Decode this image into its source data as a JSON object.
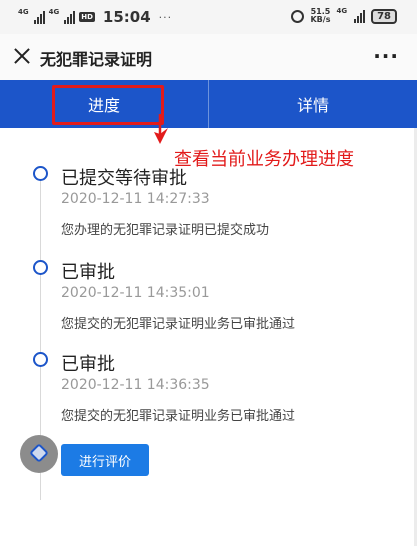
{
  "status_bar": {
    "sig1": "4G",
    "sig2": "4G",
    "hd": "HD",
    "time": "15:04",
    "dots": "···",
    "net_speed": "51.5",
    "net_unit": "KB/s",
    "net_type": "4G",
    "battery": "78"
  },
  "header": {
    "title": "无犯罪记录证明",
    "more": "···"
  },
  "tabs": [
    {
      "label": "进度"
    },
    {
      "label": "详情"
    }
  ],
  "annotation": "查看当前业务办理进度",
  "timeline": [
    {
      "title": "已提交等待审批",
      "time": "2020-12-11 14:27:33",
      "desc": "您办理的无犯罪记录证明已提交成功"
    },
    {
      "title": "已审批",
      "time": "2020-12-11 14:35:01",
      "desc": "您提交的无犯罪记录证明业务已审批通过"
    },
    {
      "title": "已审批",
      "time": "2020-12-11 14:36:35",
      "desc": "您提交的无犯罪记录证明业务已审批通过"
    }
  ],
  "evaluate_button": "进行评价",
  "colors": {
    "primary": "#1c55c9",
    "annotation": "#e21b1b",
    "button": "#1c7be5"
  }
}
